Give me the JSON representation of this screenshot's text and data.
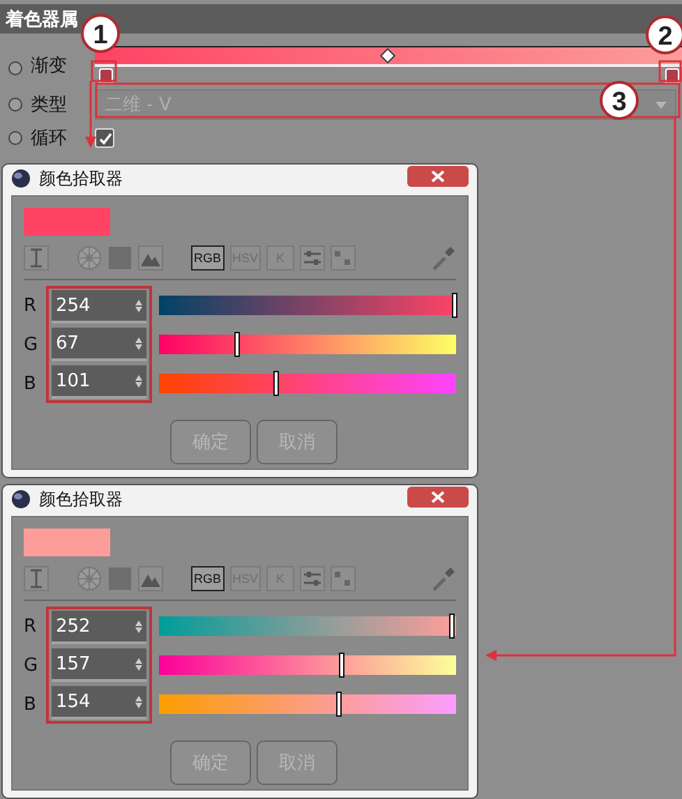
{
  "panel": {
    "title": "着色器属"
  },
  "gradient": {
    "label": "渐变",
    "selected": false
  },
  "type": {
    "label": "类型",
    "value": "二维 - V",
    "selected": false
  },
  "cycle": {
    "label": "循环",
    "checked": true,
    "selected": false
  },
  "callouts": [
    {
      "label": "1"
    },
    {
      "label": "2"
    },
    {
      "label": "3"
    }
  ],
  "dialogs": [
    {
      "title": "颜色拾取器",
      "color": "#fe4365",
      "modes": [
        {
          "label": "RGB",
          "selected": true
        },
        {
          "label": "HSV",
          "selected": false
        },
        {
          "label": "K",
          "selected": false
        }
      ],
      "channels": [
        {
          "name": "R",
          "value": "254",
          "level": 0.996
        },
        {
          "name": "G",
          "value": "67",
          "level": 0.263
        },
        {
          "name": "B",
          "value": "101",
          "level": 0.396
        }
      ],
      "buttons": [
        "确定",
        "取消"
      ]
    },
    {
      "title": "颜色拾取器",
      "color": "#fc9d9a",
      "modes": [
        {
          "label": "RGB",
          "selected": true
        },
        {
          "label": "HSV",
          "selected": false
        },
        {
          "label": "K",
          "selected": false
        }
      ],
      "channels": [
        {
          "name": "R",
          "value": "252",
          "level": 0.988
        },
        {
          "name": "G",
          "value": "157",
          "level": 0.616
        },
        {
          "name": "B",
          "value": "154",
          "level": 0.604
        }
      ],
      "buttons": [
        "确定",
        "取消"
      ]
    }
  ]
}
